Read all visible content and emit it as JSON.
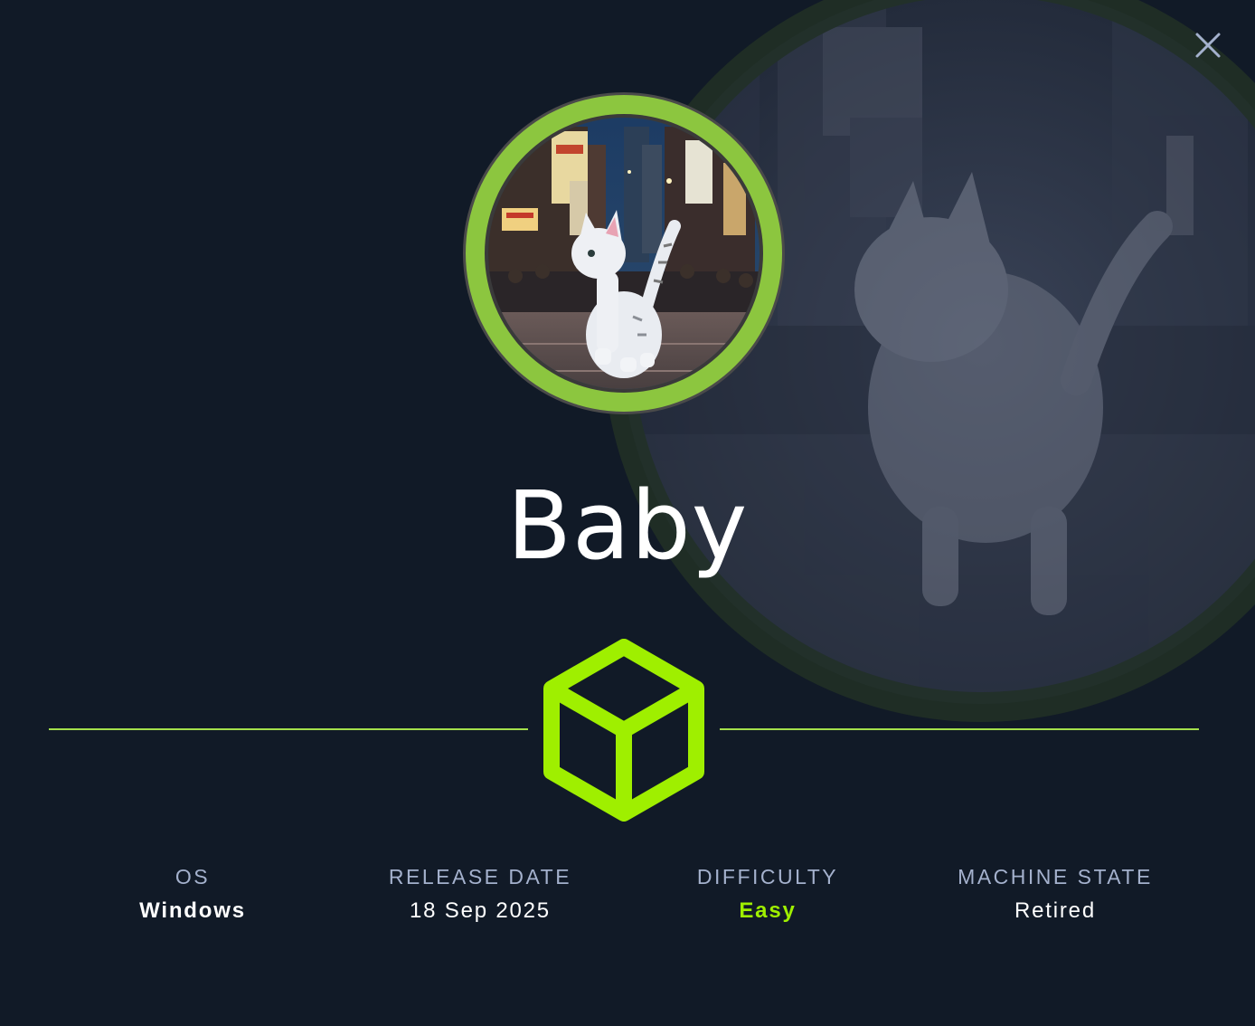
{
  "machine": {
    "name": "Baby"
  },
  "close": {
    "icon": "close-icon"
  },
  "avatar": {
    "icon": "cat-city-avatar",
    "ring_color": "#8cc63f"
  },
  "badge": {
    "icon": "cube-icon",
    "color": "#9fef00"
  },
  "stats": {
    "os": {
      "label": "OS",
      "value": "Windows"
    },
    "release_date": {
      "label": "RELEASE DATE",
      "value": "18 Sep 2025"
    },
    "difficulty": {
      "label": "DIFFICULTY",
      "value": "Easy",
      "color": "#9fef00"
    },
    "machine_state": {
      "label": "MACHINE STATE",
      "value": "Retired"
    }
  },
  "colors": {
    "background": "#111a27",
    "accent": "#9fef00",
    "label": "#a4b1cd"
  }
}
